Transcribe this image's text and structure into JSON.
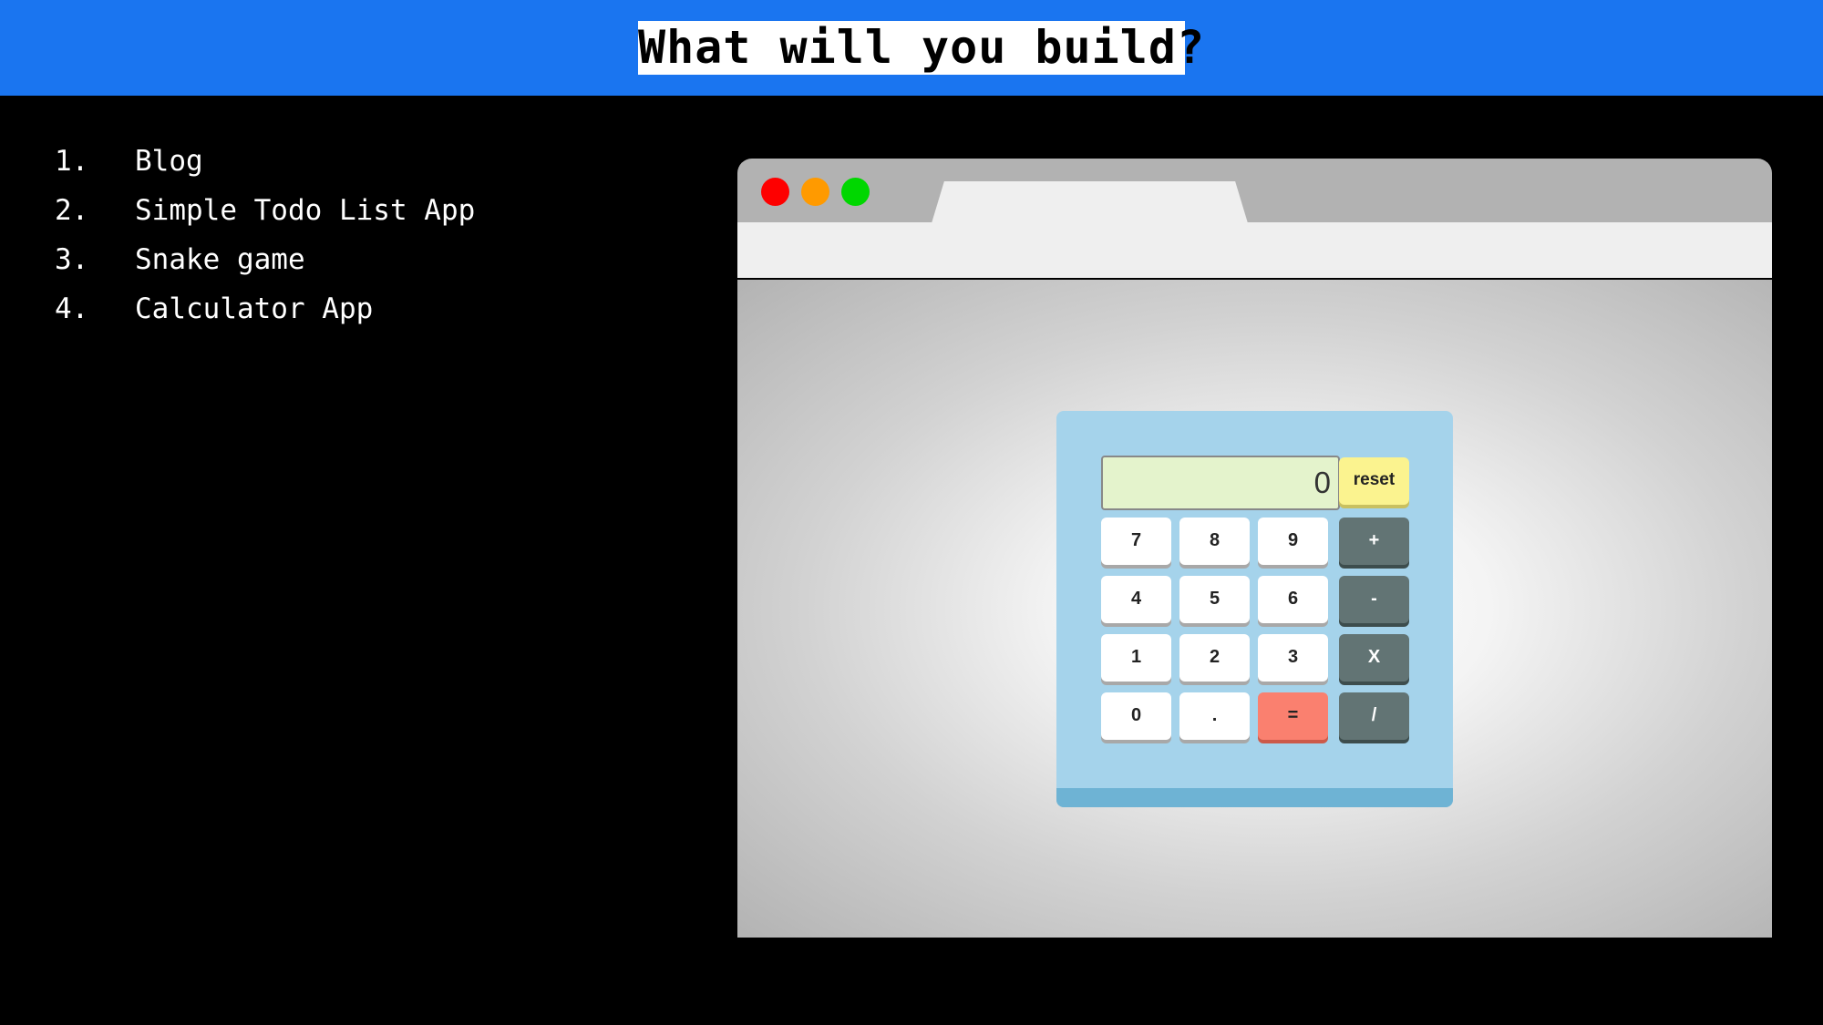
{
  "banner": {
    "title": "What will you build?"
  },
  "ideas": [
    {
      "num": "1.",
      "text": "Blog"
    },
    {
      "num": "2.",
      "text": "Simple Todo List App"
    },
    {
      "num": "3.",
      "text": "Snake game"
    },
    {
      "num": "4.",
      "text": "Calculator App"
    }
  ],
  "browser": {
    "window_controls": [
      {
        "icon": "close-dot-icon",
        "color": "#fe0000"
      },
      {
        "icon": "minimize-dot-icon",
        "color": "#ff9a00"
      },
      {
        "icon": "maximize-dot-icon",
        "color": "#00d700"
      }
    ]
  },
  "calculator": {
    "display": "0",
    "reset_label": "reset",
    "rows": [
      [
        "7",
        "8",
        "9",
        "+"
      ],
      [
        "4",
        "5",
        "6",
        "-"
      ],
      [
        "1",
        "2",
        "3",
        "X"
      ],
      [
        "0",
        ".",
        "=",
        "/"
      ]
    ],
    "colors": {
      "body": "#a5d3eb",
      "display": "#e4f3cc",
      "number_key": "#ffffff",
      "operator_key": "#627474",
      "equals_key": "#fa806f",
      "reset_key": "#fbf38f"
    }
  }
}
